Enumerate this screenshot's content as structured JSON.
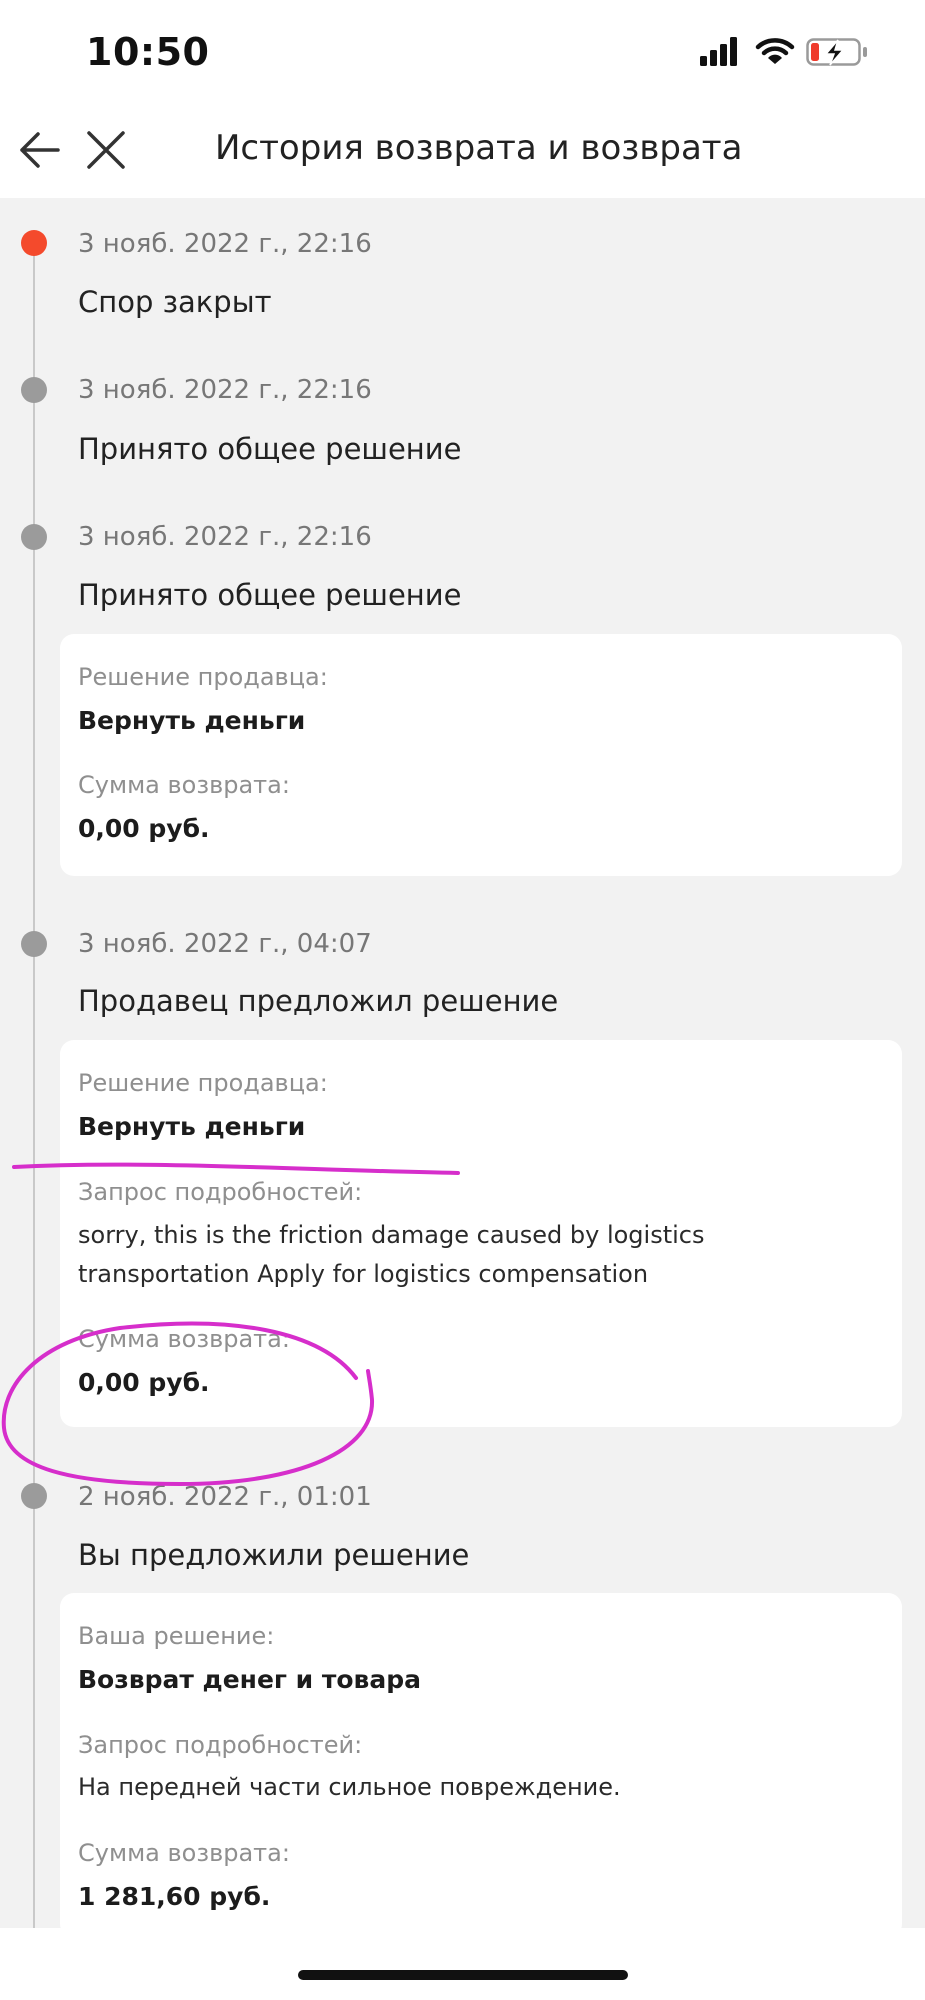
{
  "status_bar": {
    "time": "10:50"
  },
  "header": {
    "title": "История возврата и возврата"
  },
  "events": [
    {
      "date": "3 нояб. 2022 г., 22:16",
      "title": "Спор закрыт"
    },
    {
      "date": "3 нояб. 2022 г., 22:16",
      "title": "Принято общее решение"
    },
    {
      "date": "3 нояб. 2022 г., 22:16",
      "title": "Принято общее решение",
      "card": {
        "decision_label": "Решение продавца:",
        "decision_value": "Вернуть деньги",
        "amount_label": "Сумма возврата:",
        "amount_value": "0,00 руб."
      }
    },
    {
      "date": "3 нояб. 2022 г., 04:07",
      "title": "Продавец предложил решение",
      "card": {
        "decision_label": "Решение продавца:",
        "decision_value": "Вернуть деньги",
        "details_label": "Запрос подробностей:",
        "details_line1": "sorry, this is the friction damage caused by logistics",
        "details_line2": "transportation Apply for logistics compensation",
        "amount_label": "Сумма возврата:",
        "amount_value": "0,00 руб."
      }
    },
    {
      "date": "2 нояб. 2022 г., 01:01",
      "title": "Вы предложили решение",
      "card": {
        "decision_label": "Ваша решение:",
        "decision_value": "Возврат денег и товара",
        "details_label": "Запрос подробностей:",
        "details_line1": "На передней части сильное повреждение.",
        "amount_label": "Сумма возврата:",
        "amount_value": "1 281,60 руб."
      }
    }
  ],
  "colors": {
    "active_dot": "#f44a2c",
    "inactive_dot": "#9b9b9b",
    "annotation_stroke": "#d62ecb"
  }
}
